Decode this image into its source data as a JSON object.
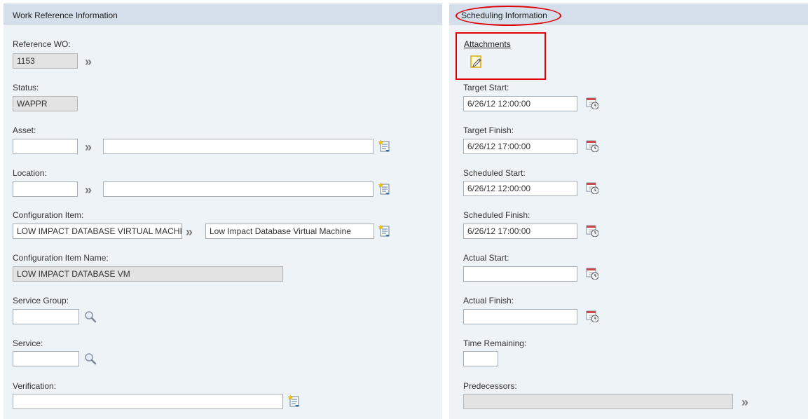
{
  "left_section": {
    "title": "Work Reference Information",
    "fields": {
      "reference_wo": {
        "label": "Reference WO:",
        "value": "1153"
      },
      "status": {
        "label": "Status:",
        "value": "WAPPR"
      },
      "asset": {
        "label": "Asset:",
        "value": "",
        "description": ""
      },
      "location": {
        "label": "Location:",
        "value": "",
        "description": ""
      },
      "config_item": {
        "label": "Configuration Item:",
        "value": "LOW IMPACT DATABASE VIRTUAL MACHINE",
        "description": "Low Impact Database Virtual Machine"
      },
      "config_item_name": {
        "label": "Configuration Item Name:",
        "value": "LOW IMPACT DATABASE VM"
      },
      "service_group": {
        "label": "Service Group:",
        "value": ""
      },
      "service": {
        "label": "Service:",
        "value": ""
      },
      "verification": {
        "label": "Verification:",
        "value": ""
      }
    }
  },
  "right_section": {
    "title": "Scheduling Information",
    "attachments": {
      "label": "Attachments"
    },
    "fields": {
      "target_start": {
        "label": "Target Start:",
        "value": "6/26/12 12:00:00"
      },
      "target_finish": {
        "label": "Target Finish:",
        "value": "6/26/12 17:00:00"
      },
      "scheduled_start": {
        "label": "Scheduled Start:",
        "value": "6/26/12 12:00:00"
      },
      "scheduled_finish": {
        "label": "Scheduled Finish:",
        "value": "6/26/12 17:00:00"
      },
      "actual_start": {
        "label": "Actual Start:",
        "value": ""
      },
      "actual_finish": {
        "label": "Actual Finish:",
        "value": ""
      },
      "time_remaining": {
        "label": "Time Remaining:",
        "value": ""
      },
      "predecessors": {
        "label": "Predecessors:",
        "value": ""
      }
    }
  },
  "icons": {
    "chevron": "»",
    "detail_menu": "detail-menu-icon",
    "calendar": "calendar-clock-icon",
    "search": "magnifier-icon",
    "attachment": "pencil-paper-icon"
  },
  "colors": {
    "annotation_red": "#e00000",
    "panel_bg": "#eef3f8",
    "header_bg": "#d4dfeb"
  }
}
